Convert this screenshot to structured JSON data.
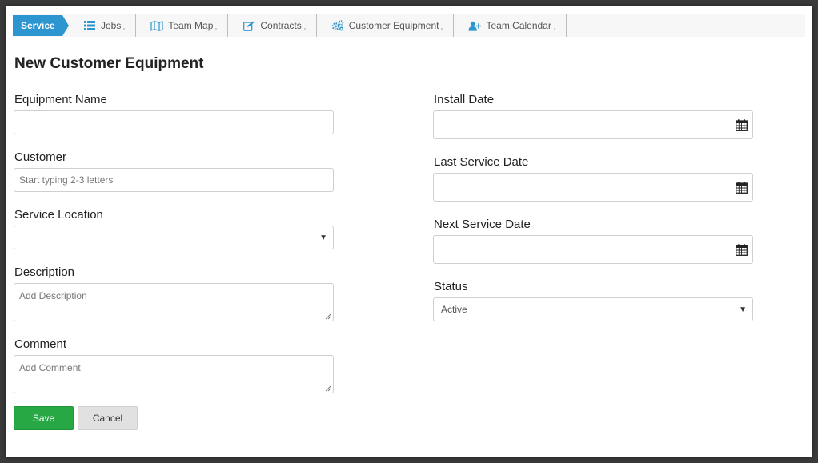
{
  "nav": {
    "home_label": "Service",
    "items": [
      {
        "label": "Jobs",
        "icon": "list-icon"
      },
      {
        "label": "Team Map",
        "icon": "map-icon"
      },
      {
        "label": "Contracts",
        "icon": "edit-icon"
      },
      {
        "label": "Customer Equipment",
        "icon": "gears-icon"
      },
      {
        "label": "Team Calendar",
        "icon": "user-plus-icon"
      }
    ],
    "accent_color": "#2d95cf"
  },
  "form": {
    "title": "New Customer Equipment",
    "equipment_name": {
      "label": "Equipment Name",
      "value": ""
    },
    "customer": {
      "label": "Customer",
      "value": "",
      "placeholder": "Start typing 2-3 letters"
    },
    "service_location": {
      "label": "Service Location",
      "value": ""
    },
    "description": {
      "label": "Description",
      "value": "",
      "placeholder": "Add Description"
    },
    "comment": {
      "label": "Comment",
      "value": "",
      "placeholder": "Add Comment"
    },
    "install_date": {
      "label": "Install Date",
      "value": ""
    },
    "last_service_date": {
      "label": "Last Service Date",
      "value": ""
    },
    "next_service_date": {
      "label": "Next Service Date",
      "value": ""
    },
    "status": {
      "label": "Status",
      "value": "Active"
    }
  },
  "buttons": {
    "save_label": "Save",
    "cancel_label": "Cancel",
    "save_color": "#28a745"
  }
}
